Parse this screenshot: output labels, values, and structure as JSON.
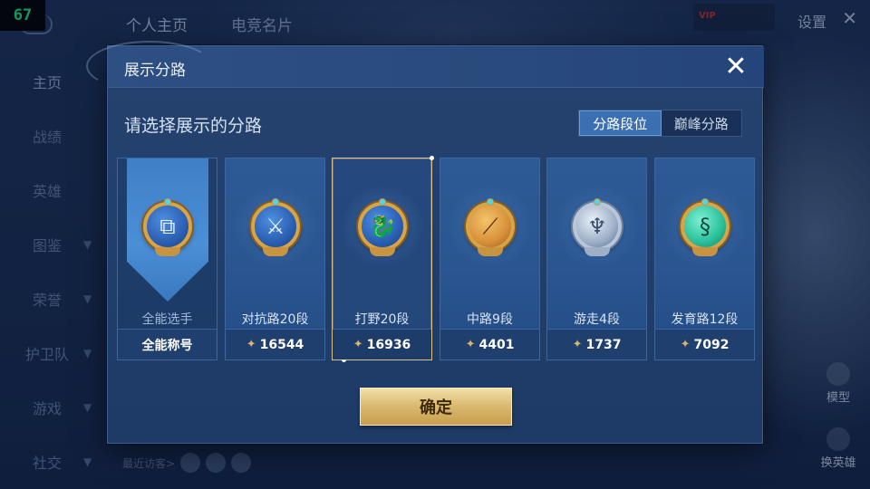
{
  "fps_counter": "67",
  "top_nav": {
    "tab_profile": "个人主页",
    "tab_second": "电竞名片",
    "settings": "设置"
  },
  "sidebar": {
    "items": [
      {
        "label": "主页",
        "has_arrow": false
      },
      {
        "label": "战绩",
        "has_arrow": false
      },
      {
        "label": "英雄",
        "has_arrow": false
      },
      {
        "label": "图鉴",
        "has_arrow": true
      },
      {
        "label": "荣誉",
        "has_arrow": true
      },
      {
        "label": "护卫队",
        "has_arrow": true
      },
      {
        "label": "游戏",
        "has_arrow": true
      },
      {
        "label": "社交",
        "has_arrow": true
      }
    ]
  },
  "right_tools": {
    "model": "模型",
    "change_hero": "换英雄"
  },
  "visitors_label": "最近访客>",
  "dialog": {
    "title": "展示分路",
    "subtitle": "请选择展示的分路",
    "close_icon": "close-icon",
    "tabs": [
      {
        "label": "分路段位",
        "active": true
      },
      {
        "label": "巅峰分路",
        "active": false
      }
    ],
    "cards": [
      {
        "label": "全能选手",
        "footer": "全能称号",
        "points": null,
        "icon": "all-round-emblem-icon",
        "selected": false
      },
      {
        "label": "对抗路20段",
        "footer": "16544",
        "points": 16544,
        "icon": "clash-lane-emblem-icon",
        "selected": false
      },
      {
        "label": "打野20段",
        "footer": "16936",
        "points": 16936,
        "icon": "jungle-emblem-icon",
        "selected": true
      },
      {
        "label": "中路9段",
        "footer": "4401",
        "points": 4401,
        "icon": "mid-lane-emblem-icon",
        "selected": false
      },
      {
        "label": "游走4段",
        "footer": "1737",
        "points": 1737,
        "icon": "roam-emblem-icon",
        "selected": false
      },
      {
        "label": "发育路12段",
        "footer": "7092",
        "points": 7092,
        "icon": "farm-lane-emblem-icon",
        "selected": false
      }
    ],
    "confirm_label": "确定"
  },
  "colors": {
    "accent_gold": "#d9b86e",
    "active_tab": "#3a6fb2",
    "fps_green": "#18e07e"
  }
}
